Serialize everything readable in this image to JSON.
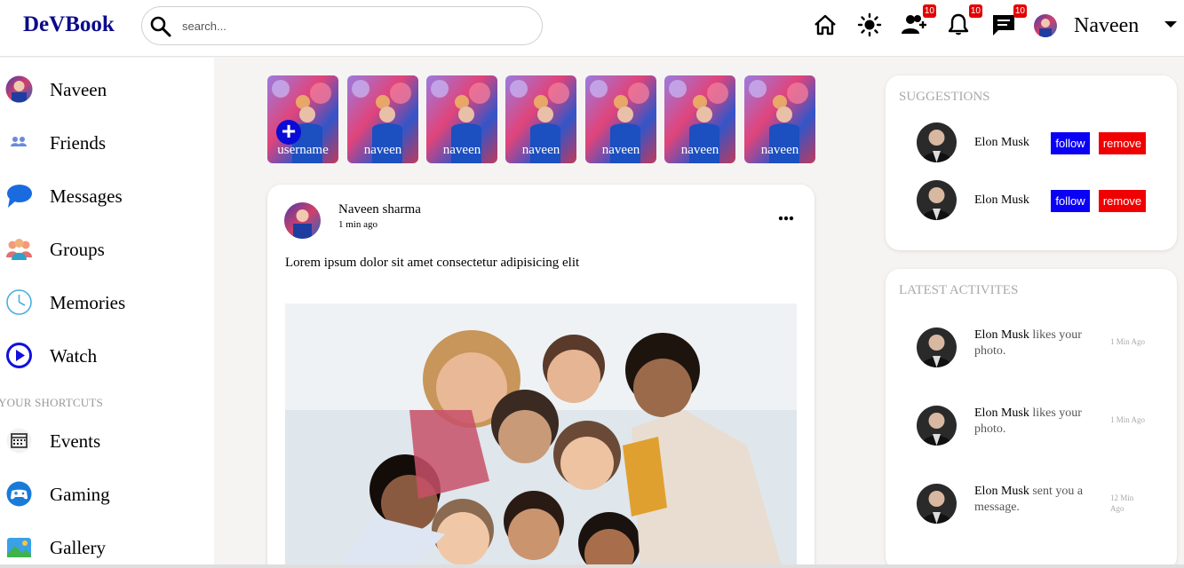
{
  "app": {
    "logo": "DeVBook"
  },
  "search": {
    "placeholder": "search..."
  },
  "topbar": {
    "user_name": "Naveen",
    "badges": {
      "friend_requests": "10",
      "notifications": "10",
      "messages": "10"
    }
  },
  "sidebar": {
    "items": [
      {
        "label": "Naveen"
      },
      {
        "label": "Friends"
      },
      {
        "label": "Messages"
      },
      {
        "label": "Groups"
      },
      {
        "label": "Memories"
      },
      {
        "label": "Watch"
      }
    ],
    "shortcuts_title": "YOUR SHORTCUTS",
    "shortcuts": [
      {
        "label": "Events"
      },
      {
        "label": "Gaming"
      },
      {
        "label": "Gallery"
      }
    ]
  },
  "stories": [
    {
      "label": "username"
    },
    {
      "label": "naveen"
    },
    {
      "label": "naveen"
    },
    {
      "label": "naveen"
    },
    {
      "label": "naveen"
    },
    {
      "label": "naveen"
    },
    {
      "label": "naveen"
    }
  ],
  "post": {
    "author": "Naveen sharma",
    "time": "1 min ago",
    "text": "Lorem ipsum dolor sit amet consectetur adipisicing elit"
  },
  "suggestions": {
    "title": "SUGGESTIONS",
    "follow_label": "follow",
    "remove_label": "remove",
    "people": [
      {
        "name": "Elon Musk"
      },
      {
        "name": "Elon Musk"
      }
    ]
  },
  "activities": {
    "title": "LATEST ACTIVITES",
    "items": [
      {
        "who": "Elon Musk",
        "action": " likes your photo.",
        "when": "1 Min Ago"
      },
      {
        "who": "Elon Musk",
        "action": " likes your photo.",
        "when": "1 Min Ago"
      },
      {
        "who": "Elon Musk",
        "action": " sent you a message.",
        "when": "12 Min Ago"
      }
    ]
  },
  "colors": {
    "logo": "#0b0b8a",
    "follow": "#0a00f5",
    "remove": "#f00000",
    "badge": "#e40000"
  }
}
